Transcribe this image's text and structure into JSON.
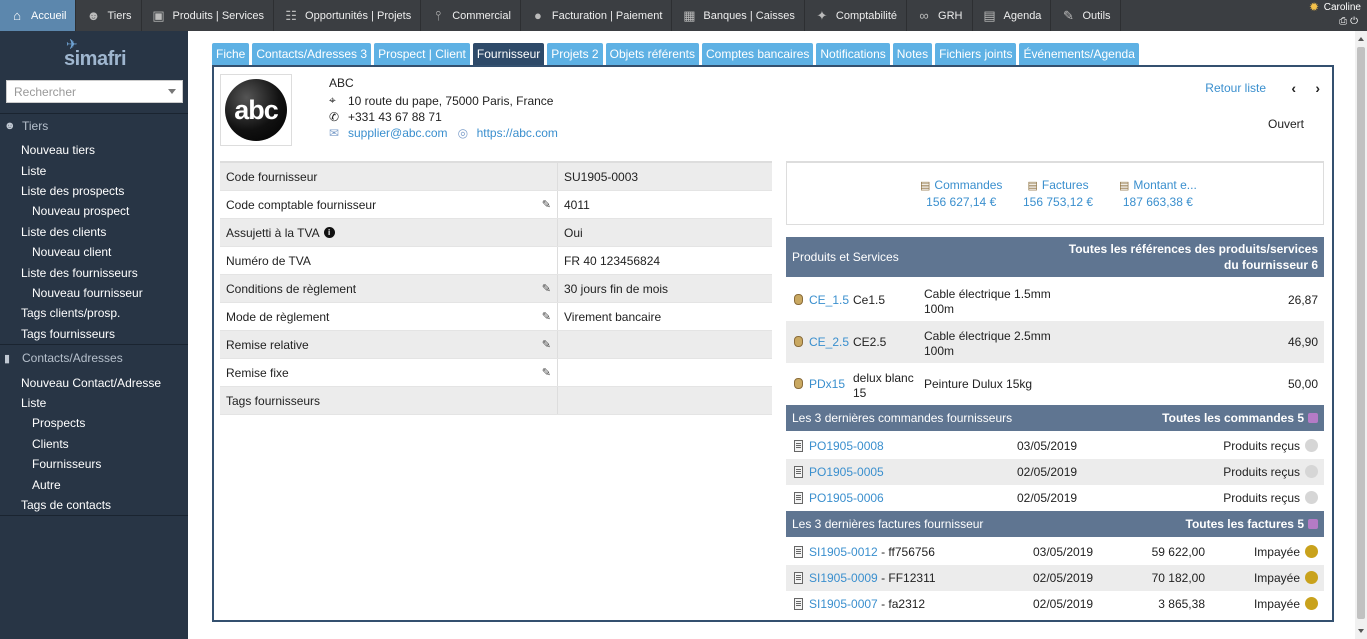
{
  "topbar": {
    "items": [
      {
        "label": "Accueil",
        "icon": "home-icon"
      },
      {
        "label": "Tiers",
        "icon": "users-icon"
      },
      {
        "label": "Produits | Services",
        "icon": "box-icon"
      },
      {
        "label": "Opportunités | Projets",
        "icon": "sitemap-icon"
      },
      {
        "label": "Commercial",
        "icon": "tie-icon"
      },
      {
        "label": "Facturation | Paiement",
        "icon": "piggy-bank-icon"
      },
      {
        "label": "Banques | Caisses",
        "icon": "bank-icon"
      },
      {
        "label": "Comptabilité",
        "icon": "ledger-icon"
      },
      {
        "label": "GRH",
        "icon": "binoculars-icon"
      },
      {
        "label": "Agenda",
        "icon": "calendar-icon"
      },
      {
        "label": "Outils",
        "icon": "tools-icon"
      }
    ],
    "user": "Caroline"
  },
  "sidebar": {
    "logo": "simafri",
    "search_placeholder": "Rechercher",
    "tiers_header": "Tiers",
    "tiers_items": [
      "Nouveau tiers",
      "Liste",
      "Liste des prospects",
      "Nouveau prospect",
      "Liste des clients",
      "Nouveau client",
      "Liste des fournisseurs",
      "Nouveau fournisseur",
      "Tags clients/prosp.",
      "Tags fournisseurs"
    ],
    "contacts_header": "Contacts/Adresses",
    "contacts_items": [
      "Nouveau Contact/Adresse",
      "Liste",
      "Prospects",
      "Clients",
      "Fournisseurs",
      "Autre",
      "Tags de contacts"
    ]
  },
  "tabs": [
    "Fiche",
    "Contacts/Adresses 3",
    "Prospect | Client",
    "Fournisseur",
    "Projets 2",
    "Objets référents",
    "Comptes bancaires",
    "Notifications",
    "Notes",
    "Fichiers joints",
    "Événements/Agenda"
  ],
  "company": {
    "logo_text": "abc",
    "name": "ABC",
    "address": "10 route du pape, 75000 Paris, France",
    "phone": "+331 43 67 88 71",
    "email": "supplier@abc.com",
    "website": "https://abc.com",
    "back_label": "Retour liste",
    "prev": "‹",
    "next": "›",
    "status": "Ouvert"
  },
  "fields": [
    {
      "label": "Code fournisseur",
      "value": "SU1905-0003"
    },
    {
      "label": "Code comptable fournisseur",
      "value": "4011"
    },
    {
      "label": "Assujetti à la TVA",
      "value": "Oui"
    },
    {
      "label": "Numéro de TVA",
      "value": "FR 40 123456824"
    },
    {
      "label": "Conditions de règlement",
      "value": "30 jours fin de mois"
    },
    {
      "label": "Mode de règlement",
      "value": "Virement bancaire"
    },
    {
      "label": "Remise relative",
      "value": ""
    },
    {
      "label": "Remise fixe",
      "value": ""
    },
    {
      "label": "Tags fournisseurs",
      "value": ""
    }
  ],
  "stats": [
    {
      "label": "Commandes",
      "value": "156 627,14 €"
    },
    {
      "label": "Factures",
      "value": "156 753,12 €"
    },
    {
      "label": "Montant e...",
      "value": "187 663,38 €"
    }
  ],
  "products": {
    "title": "Produits et Services",
    "link": "Toutes les références des produits/services du fournisseur 6",
    "rows": [
      {
        "ref": "CE_1.5",
        "label": "Ce1.5",
        "desc": "Cable électrique 1.5mm 100m",
        "price": "26,87"
      },
      {
        "ref": "CE_2.5",
        "label": "CE2.5",
        "desc": "Cable électrique 2.5mm 100m",
        "price": "46,90"
      },
      {
        "ref": "PDx15",
        "label": "delux blanc 15",
        "desc": "Peinture Dulux 15kg",
        "price": "50,00"
      }
    ]
  },
  "orders": {
    "title": "Les 3 dernières commandes fournisseurs",
    "link": "Toutes les commandes 5",
    "rows": [
      {
        "ref": "PO1905-0008",
        "date": "03/05/2019",
        "status": "Produits reçus"
      },
      {
        "ref": "PO1905-0005",
        "date": "02/05/2019",
        "status": "Produits reçus"
      },
      {
        "ref": "PO1905-0006",
        "date": "02/05/2019",
        "status": "Produits reçus"
      }
    ]
  },
  "invoices": {
    "title": "Les 3 dernières factures fournisseur",
    "link": "Toutes les factures 5",
    "rows": [
      {
        "ref": "SI1905-0012",
        "supref": " - ff756756",
        "date": "03/05/2019",
        "amount": "59 622,00",
        "status": "Impayée"
      },
      {
        "ref": "SI1905-0009",
        "supref": " - FF12311",
        "date": "02/05/2019",
        "amount": "70 182,00",
        "status": "Impayée"
      },
      {
        "ref": "SI1905-0007",
        "supref": " - fa2312",
        "date": "02/05/2019",
        "amount": "3 865,38",
        "status": "Impayée"
      }
    ]
  }
}
